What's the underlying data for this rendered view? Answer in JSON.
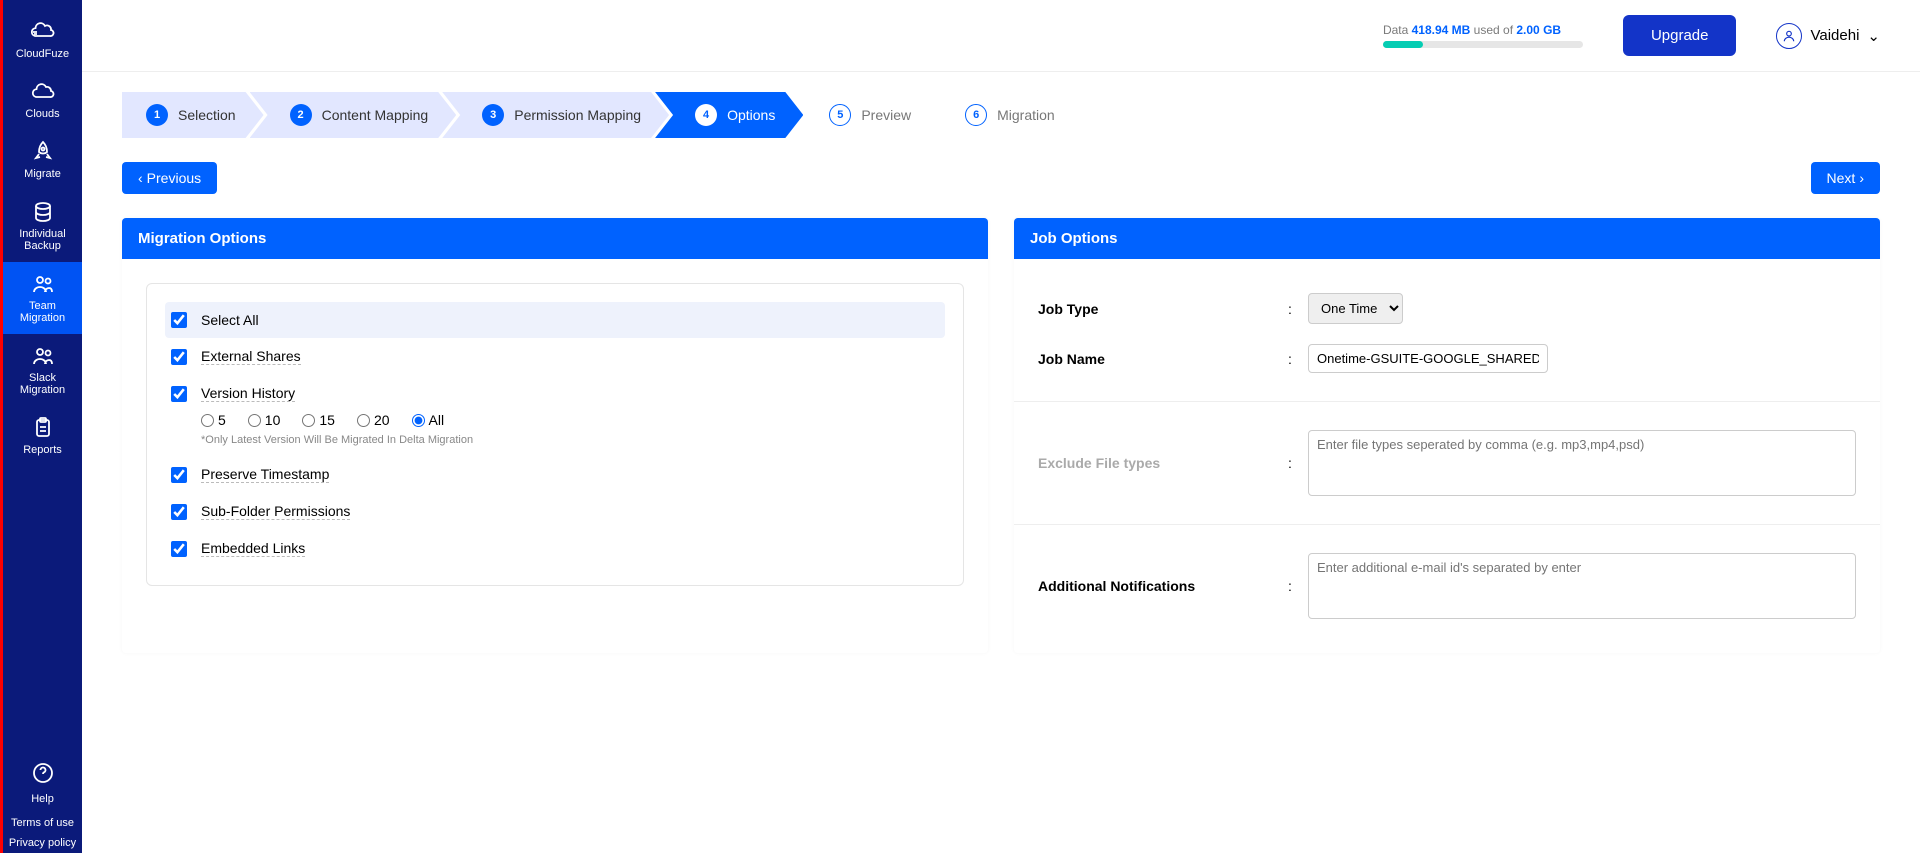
{
  "sidebar": {
    "logo": "CloudFuze",
    "items": [
      {
        "label": "Clouds"
      },
      {
        "label": "Migrate"
      },
      {
        "label": "Individual Backup"
      },
      {
        "label": "Team Migration"
      },
      {
        "label": "Slack Migration"
      },
      {
        "label": "Reports"
      }
    ],
    "help": "Help",
    "terms": "Terms of use",
    "privacy": "Privacy policy"
  },
  "topbar": {
    "data_prefix": "Data ",
    "data_used": "418.94 MB",
    "data_middle": " used of ",
    "data_total": "2.00 GB",
    "upgrade": "Upgrade",
    "user": "Vaidehi"
  },
  "stepper": [
    {
      "num": "1",
      "label": "Selection"
    },
    {
      "num": "2",
      "label": "Content Mapping"
    },
    {
      "num": "3",
      "label": "Permission Mapping"
    },
    {
      "num": "4",
      "label": "Options"
    },
    {
      "num": "5",
      "label": "Preview"
    },
    {
      "num": "6",
      "label": "Migration"
    }
  ],
  "nav": {
    "prev": "Previous",
    "next": "Next"
  },
  "migration": {
    "title": "Migration Options",
    "select_all": "Select All",
    "external_shares": "External Shares",
    "version_history": "Version History",
    "vh_radios": [
      "5",
      "10",
      "15",
      "20",
      "All"
    ],
    "vh_note": "*Only Latest Version Will Be Migrated In Delta Migration",
    "preserve_timestamp": "Preserve Timestamp",
    "sub_folder_permissions": "Sub-Folder Permissions",
    "embedded_links": "Embedded Links"
  },
  "job": {
    "title": "Job Options",
    "job_type_label": "Job Type",
    "job_type_value": "One Time",
    "job_name_label": "Job Name",
    "job_name_value": "Onetime-GSUITE-GOOGLE_SHARED",
    "exclude_label": "Exclude File types",
    "exclude_placeholder": "Enter file types seperated by comma (e.g. mp3,mp4,psd)",
    "notif_label": "Additional Notifications",
    "notif_placeholder": "Enter additional e-mail id's separated by enter"
  }
}
